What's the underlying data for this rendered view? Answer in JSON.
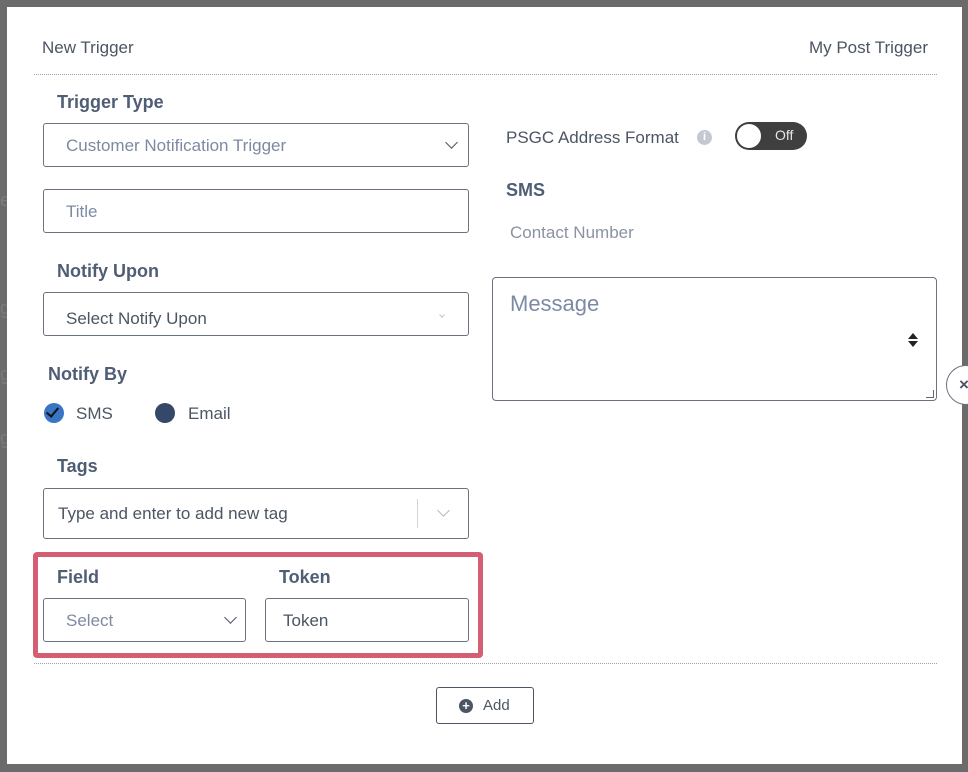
{
  "header": {
    "left_title": "New Trigger",
    "right_title": "My Post Trigger"
  },
  "trigger_type": {
    "label": "Trigger Type",
    "selected": "Customer Notification Trigger"
  },
  "title_input": {
    "placeholder": "Title",
    "value": ""
  },
  "notify_upon": {
    "label": "Notify Upon",
    "placeholder": "Select Notify Upon"
  },
  "notify_by": {
    "label": "Notify By",
    "options": [
      {
        "label": "SMS",
        "checked": true
      },
      {
        "label": "Email",
        "checked": false
      }
    ]
  },
  "tags": {
    "label": "Tags",
    "placeholder": "Type and enter to add new tag"
  },
  "field": {
    "label": "Field",
    "placeholder": "Select"
  },
  "token": {
    "label": "Token",
    "placeholder": "Token"
  },
  "psgc": {
    "label": "PSGC Address Format",
    "toggle_state": "Off",
    "info_icon": "info-icon"
  },
  "sms": {
    "label": "SMS",
    "contact_placeholder": "Contact Number",
    "message_placeholder": "Message"
  },
  "add_button": {
    "label": "Add",
    "icon": "plus-circle-icon"
  },
  "colors": {
    "highlight": "#d45f72",
    "toggle_bg": "#3f3f3f",
    "radio_checked": "#3a74c4",
    "radio_unchecked": "#354868"
  }
}
